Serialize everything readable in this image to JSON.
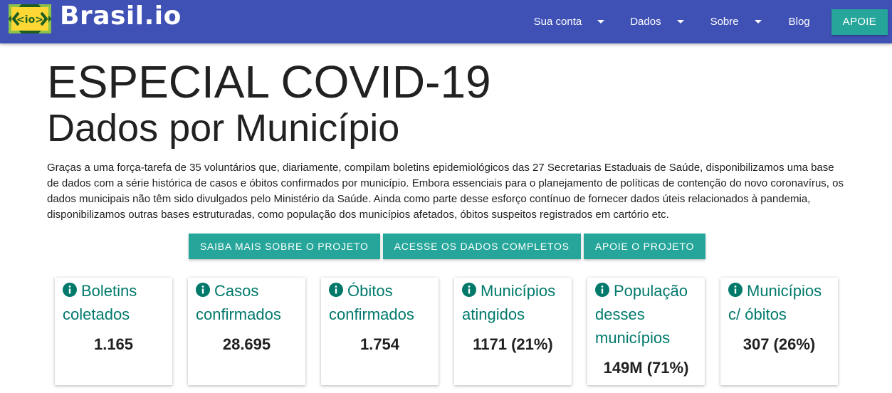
{
  "navbar": {
    "logo_text": "Brasil.io",
    "logo_mark": "<io>",
    "menu": [
      {
        "label": "Sua conta",
        "has_dropdown": true
      },
      {
        "label": "Dados",
        "has_dropdown": true
      },
      {
        "label": "Sobre",
        "has_dropdown": true
      },
      {
        "label": "Blog",
        "has_dropdown": false
      }
    ],
    "apoie_label": "APOIE"
  },
  "page": {
    "title": "ESPECIAL COVID-19",
    "subtitle": "Dados por Município",
    "intro": "Graças a uma força-tarefa de 35 voluntários que, diariamente, compilam boletins epidemiológicos das 27 Secretarias Estaduais de Saúde, disponibilizamos uma base de dados com a série histórica de casos e óbitos confirmados por município. Embora essenciais para o planejamento de políticas de contenção do novo coronavírus, os dados municipais não têm sido divulgados pelo Ministério da Saúde. Ainda como parte desse esforço contínuo de fornecer dados úteis relacionados à pandemia, disponibilizamos outras bases estruturadas, como população dos municípios afetados, óbitos suspeitos registrados em cartório etc.",
    "cta_buttons": [
      "Saiba mais sobre o projeto",
      "Acesse os dados completos",
      "Apoie o projeto"
    ]
  },
  "cards": [
    {
      "title": "Boletins coletados",
      "value": "1.165",
      "icon": "info-icon"
    },
    {
      "title": "Casos confirmados",
      "value": "28.695",
      "icon": "info-icon"
    },
    {
      "title": "Óbitos confirmados",
      "value": "1.754",
      "icon": "info-icon"
    },
    {
      "title": "Municípios atingidos",
      "value": "1171 (21%)",
      "icon": "info-icon"
    },
    {
      "title": "População desses municípios",
      "value": "149M (71%)",
      "icon": "info-icon"
    },
    {
      "title": "Municípios c/ óbitos",
      "value": "307 (26%)",
      "icon": "info-icon"
    }
  ],
  "colors": {
    "navbar": "#3f51b5",
    "accent": "#26a69a",
    "card_title": "#00796b",
    "logo_green": "#8bc34a",
    "logo_yellow": "#fdd835"
  }
}
